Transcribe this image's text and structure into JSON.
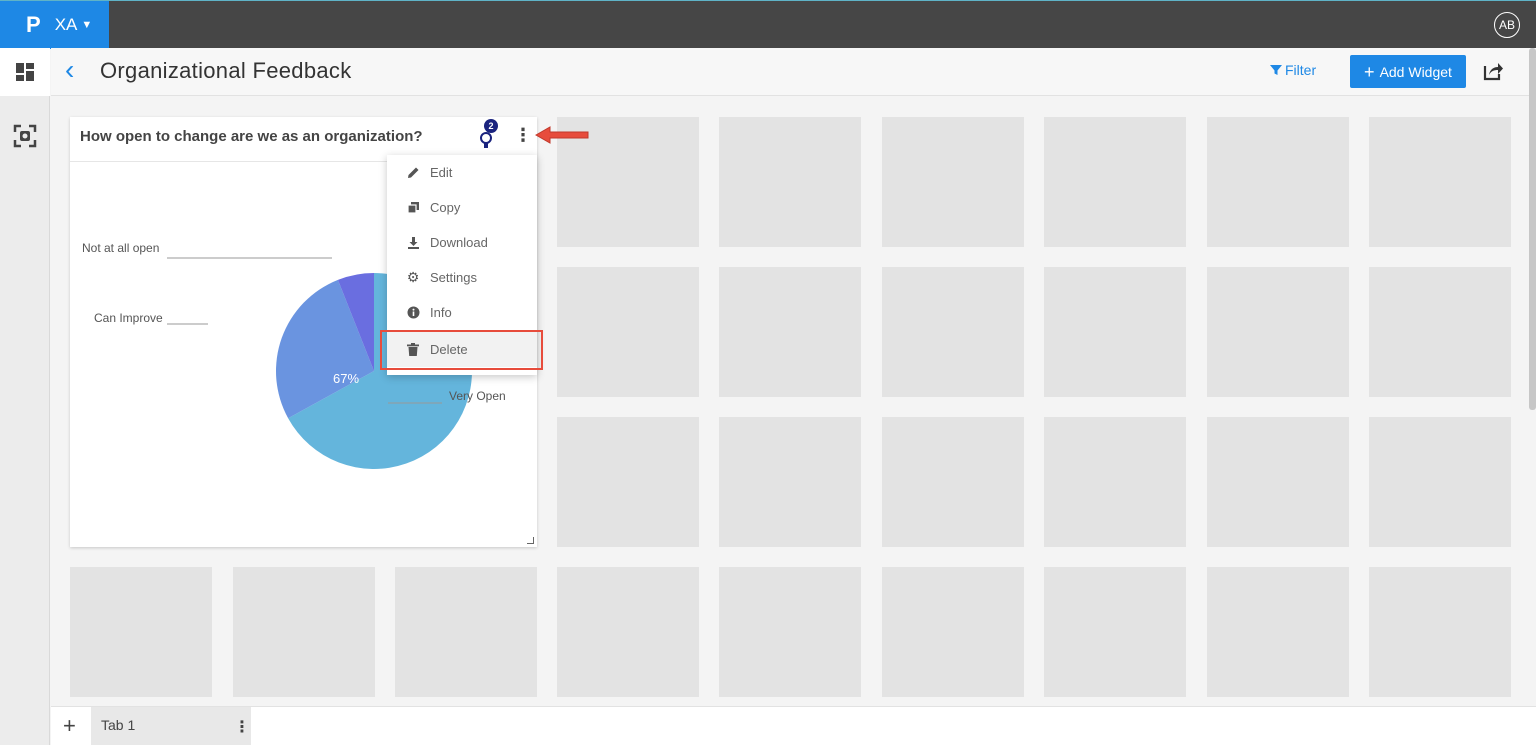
{
  "app": {
    "logo": "P",
    "workspace": "XA",
    "user_initials": "AB"
  },
  "header": {
    "title": "Organizational Feedback",
    "filter_label": "Filter",
    "add_widget_label": "Add Widget"
  },
  "widget": {
    "title": "How open to change are we as an organization?",
    "insight_count": "2",
    "chart_data": {
      "type": "pie",
      "categories": [
        "Very Open",
        "Can Improve",
        "Not at all open"
      ],
      "values": [
        67,
        27,
        6
      ],
      "data_labels": [
        "67%",
        "27%",
        ""
      ],
      "colors": [
        "#64b5dc",
        "#6a94e0",
        "#6a6ee0"
      ]
    }
  },
  "menu": {
    "items": [
      {
        "label": "Edit",
        "icon": "pencil-icon"
      },
      {
        "label": "Copy",
        "icon": "copy-icon"
      },
      {
        "label": "Download",
        "icon": "download-icon"
      },
      {
        "label": "Settings",
        "icon": "gear-icon"
      },
      {
        "label": "Info",
        "icon": "info-icon"
      },
      {
        "label": "Delete",
        "icon": "trash-icon"
      }
    ]
  },
  "tabs": [
    {
      "label": "Tab 1"
    }
  ],
  "colors": {
    "accent": "#1e88e5",
    "topbar": "#464646",
    "annotation": "#e74c3c"
  }
}
